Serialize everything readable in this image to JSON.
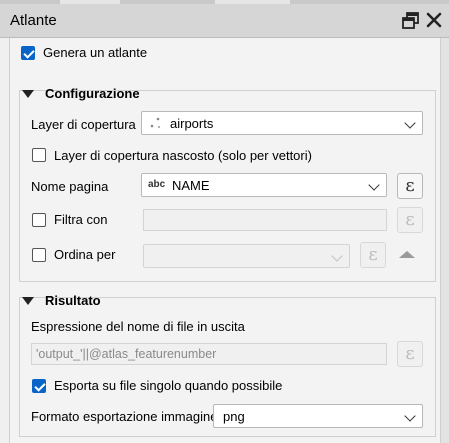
{
  "panel": {
    "title": "Atlante",
    "generate_atlas_label": "Genera un atlante",
    "generate_atlas_checked": true
  },
  "configuration": {
    "title": "Configurazione",
    "coverage_layer_label": "Layer di copertura",
    "coverage_layer_value": "airports",
    "hidden_coverage_label": "Layer di copertura nascosto (solo per vettori)",
    "hidden_coverage_checked": false,
    "page_name_label": "Nome pagina",
    "page_name_type": "abc",
    "page_name_value": "NAME",
    "filter_label": "Filtra con",
    "filter_checked": false,
    "filter_value": "",
    "sort_label": "Ordina per",
    "sort_checked": false,
    "sort_value": ""
  },
  "output": {
    "title": "Risultato",
    "filename_expr_label": "Espressione del nome di file in uscita",
    "filename_expr_value": "'output_'||@atlas_featurenumber",
    "single_file_label": "Esporta su file singolo quando possibile",
    "single_file_checked": true,
    "image_format_label": "Formato esportazione immagine",
    "image_format_value": "png"
  },
  "icons": {
    "expression": "ε",
    "float": "float-window-icon",
    "close": "close-icon"
  }
}
